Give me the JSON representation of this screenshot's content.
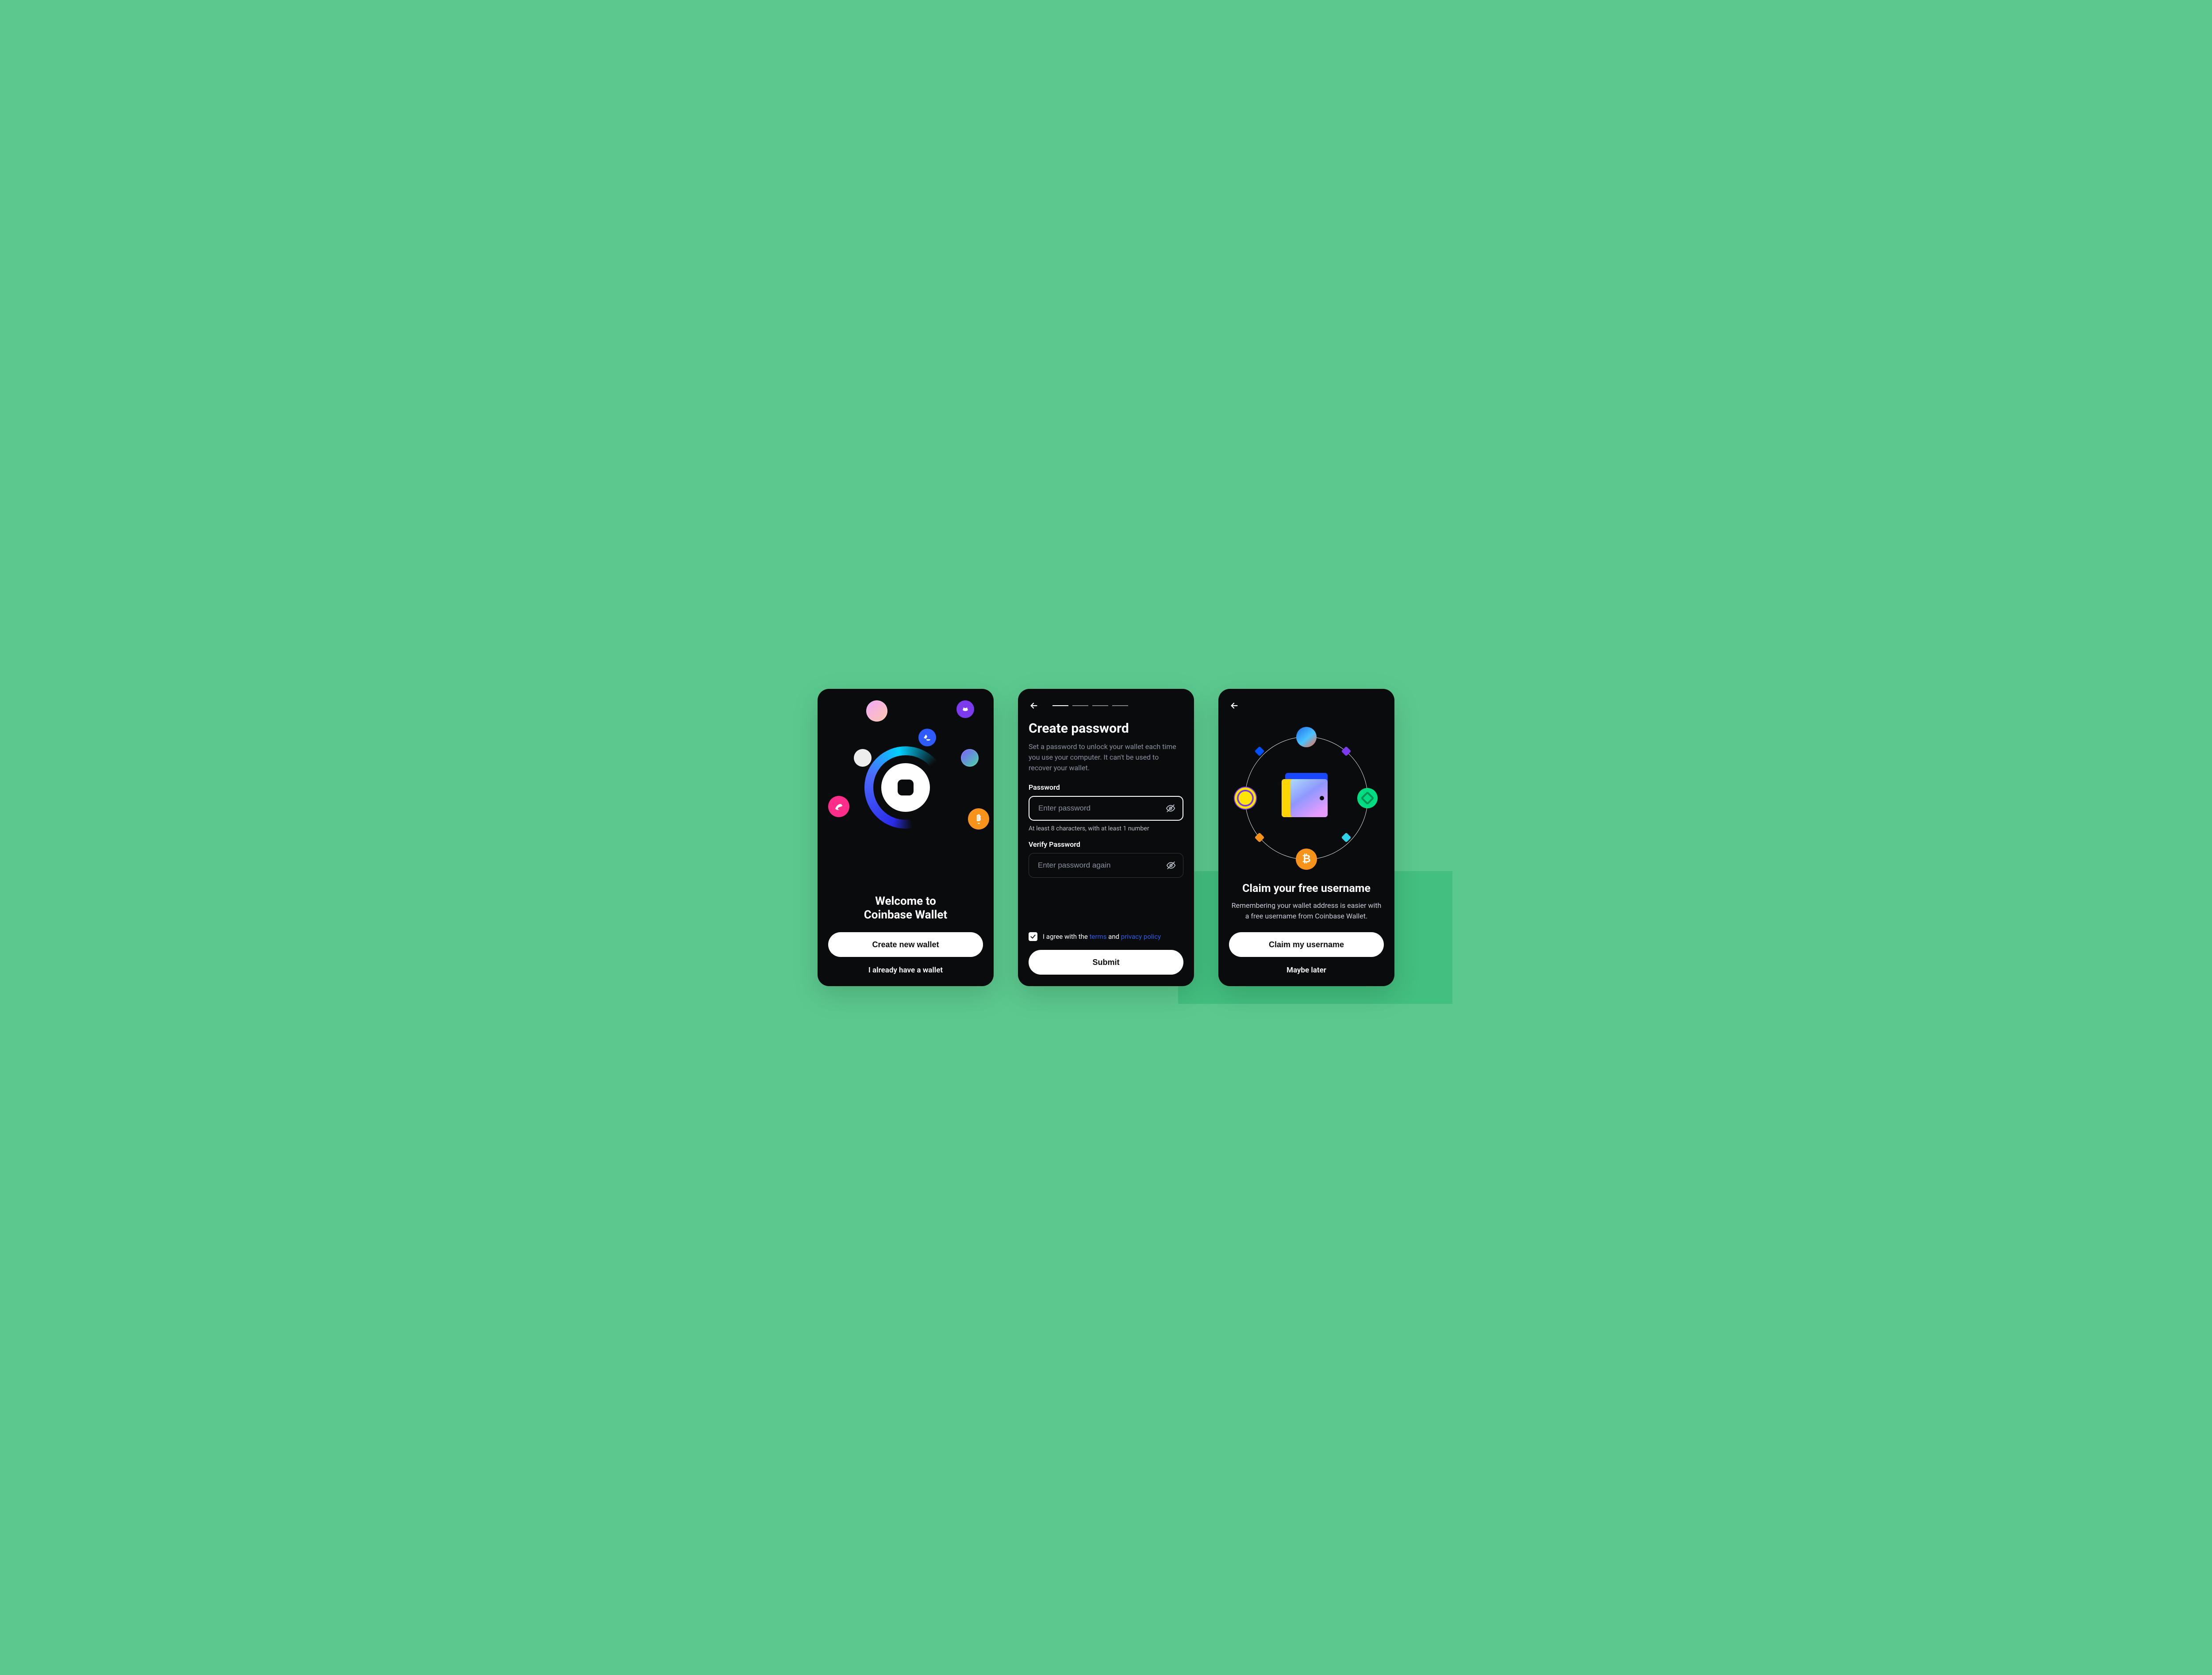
{
  "screen1": {
    "title_line1": "Welcome to",
    "title_line2": "Coinbase Wallet",
    "primary_button": "Create new wallet",
    "secondary_link": "I already have a wallet"
  },
  "screen2": {
    "progress_total": 4,
    "progress_current": 1,
    "title": "Create password",
    "description": "Set a password to unlock your wallet each time you use your computer. It can't be used to recover your wallet.",
    "password_label": "Password",
    "password_placeholder": "Enter password",
    "password_hint": "At least 8 characters, with at least 1 number",
    "verify_label": "Verify Password",
    "verify_placeholder": "Enter password again",
    "agree_prefix": "I agree with the ",
    "agree_terms": "terms",
    "agree_and": " and ",
    "agree_privacy": "privacy policy",
    "agree_checked": true,
    "submit_button": "Submit"
  },
  "screen3": {
    "title": "Claim your free username",
    "description": "Remembering your wallet address is easier with a free username from Coinbase Wallet.",
    "primary_button": "Claim my username",
    "secondary_link": "Maybe later"
  }
}
